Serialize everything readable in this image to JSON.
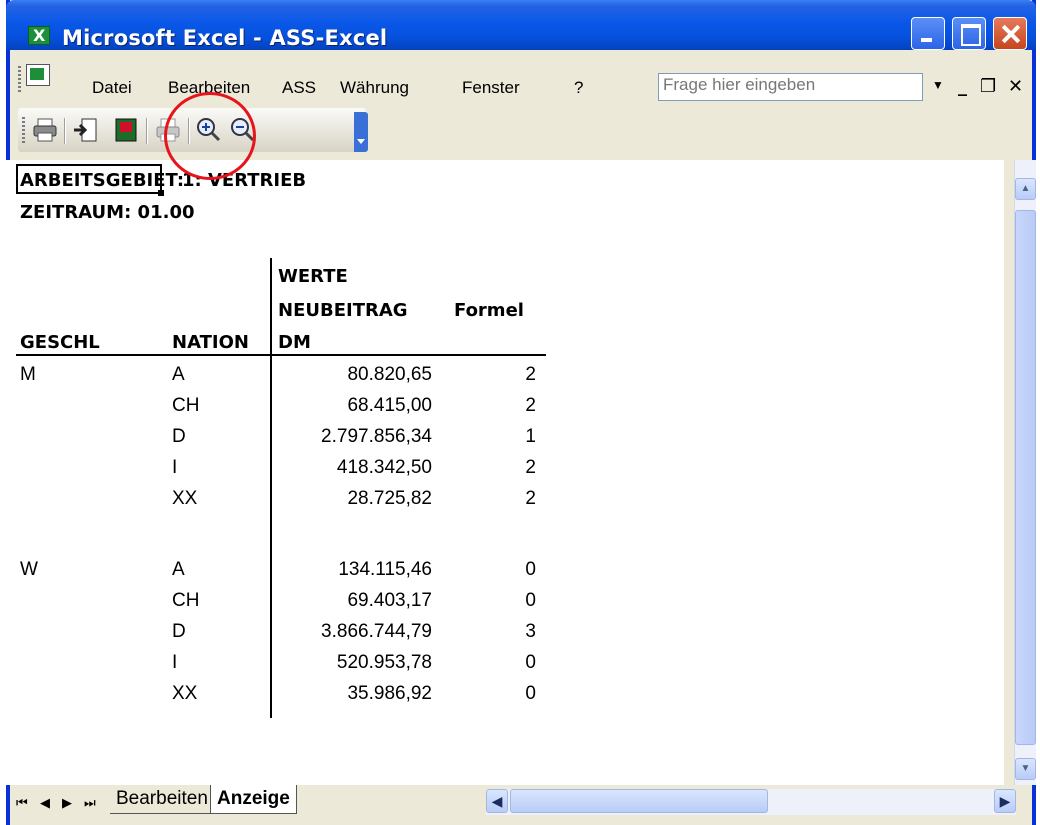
{
  "window": {
    "title": "Microsoft Excel - ASS-Excel"
  },
  "menubar": {
    "items": [
      "Datei",
      "Bearbeiten",
      "ASS",
      "Währung",
      "Fenster",
      "?"
    ],
    "help_placeholder": "Frage hier eingeben"
  },
  "toolbar": {
    "icons": [
      "print-icon",
      "import-icon",
      "exit-icon",
      "print-preview-icon",
      "zoom-in-icon",
      "zoom-out-icon"
    ]
  },
  "sheet": {
    "arbeitsgebiet_label": "ARBEITSGEBIET:",
    "arbeitsgebiet_value": "1: VERTRIEB",
    "zeitraum": "ZEITRAUM: 01.00",
    "headers": {
      "werte": "WERTE",
      "neubeitrag": "NEUBEITRAG",
      "formel": "Formel",
      "geschl": "GESCHL",
      "nation": "NATION",
      "dm": "DM"
    },
    "groups": [
      {
        "geschl": "M",
        "rows": [
          {
            "nation": "A",
            "value": "80.820,65",
            "formel": "2"
          },
          {
            "nation": "CH",
            "value": "68.415,00",
            "formel": "2"
          },
          {
            "nation": "D",
            "value": "2.797.856,34",
            "formel": "1"
          },
          {
            "nation": "I",
            "value": "418.342,50",
            "formel": "2"
          },
          {
            "nation": "XX",
            "value": "28.725,82",
            "formel": "2"
          }
        ]
      },
      {
        "geschl": "W",
        "rows": [
          {
            "nation": "A",
            "value": "134.115,46",
            "formel": "0"
          },
          {
            "nation": "CH",
            "value": "69.403,17",
            "formel": "0"
          },
          {
            "nation": "D",
            "value": "3.866.744,79",
            "formel": "3"
          },
          {
            "nation": "I",
            "value": "520.953,78",
            "formel": "0"
          },
          {
            "nation": "XX",
            "value": "35.986,92",
            "formel": "0"
          }
        ]
      }
    ]
  },
  "tabs": {
    "items": [
      "Bearbeiten",
      "Anzeige"
    ],
    "active": "Anzeige"
  },
  "colors": {
    "titlebar": "#0a58e8",
    "annotation_circle": "#e8141b"
  }
}
